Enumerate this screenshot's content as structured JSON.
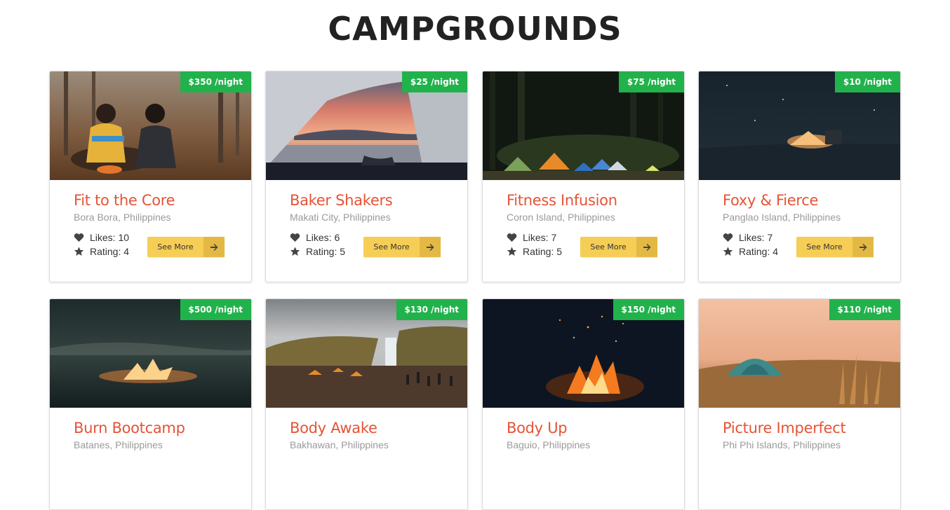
{
  "page": {
    "title": "CAMPGROUNDS"
  },
  "ui": {
    "see_more_label": "See More"
  },
  "icons": {
    "likes": "heart-icon",
    "rating": "star-icon",
    "button": "arrow-right-icon"
  },
  "colors": {
    "price_badge": "#21b24b",
    "name": "#e55336",
    "button": "#f6ce55"
  },
  "campgrounds": [
    {
      "name": "Fit to the Core",
      "location": "Bora Bora, Philippines",
      "price": "$350 /night",
      "likes": "Likes: 10",
      "rating": "Rating: 4"
    },
    {
      "name": "Baker Shakers",
      "location": "Makati City, Philippines",
      "price": "$25 /night",
      "likes": "Likes: 6",
      "rating": "Rating: 5"
    },
    {
      "name": "Fitness Infusion",
      "location": "Coron Island, Philippines",
      "price": "$75 /night",
      "likes": "Likes: 7",
      "rating": "Rating: 5"
    },
    {
      "name": "Foxy & Fierce",
      "location": "Panglao Island, Philippines",
      "price": "$10 /night",
      "likes": "Likes: 7",
      "rating": "Rating: 4"
    },
    {
      "name": "Burn Bootcamp",
      "location": "Batanes, Philippines",
      "price": "$500 /night",
      "likes": "",
      "rating": ""
    },
    {
      "name": "Body Awake",
      "location": "Bakhawan, Philippines",
      "price": "$130 /night",
      "likes": "",
      "rating": ""
    },
    {
      "name": "Body Up",
      "location": "Baguio, Philippines",
      "price": "$150 /night",
      "likes": "",
      "rating": ""
    },
    {
      "name": "Picture Imperfect",
      "location": "Phi Phi Islands, Philippines",
      "price": "$110 /night",
      "likes": "",
      "rating": ""
    }
  ]
}
